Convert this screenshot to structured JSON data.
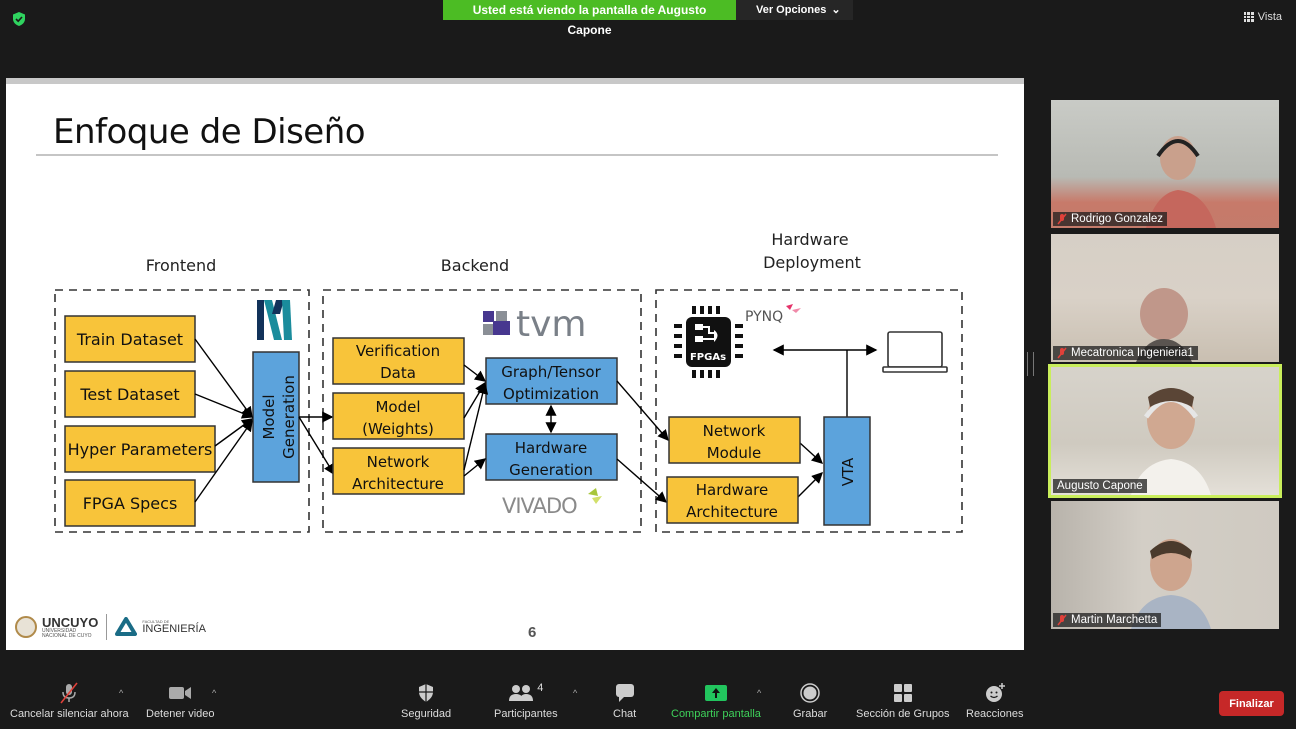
{
  "topbar": {
    "sharing_banner": "Usted está viendo la pantalla de Augusto Capone",
    "view_options": "Ver Opciones",
    "view_label": "Vista"
  },
  "slide": {
    "title": "Enfoque de Diseño",
    "page_number": "6",
    "footer": {
      "university": "UNCUYO",
      "university_sub1": "UNIVERSIDAD",
      "university_sub2": "NACIONAL DE CUYO",
      "faculty_sub": "FACULTAD DE",
      "faculty": "INGENIERÍA"
    },
    "diagram": {
      "sections": {
        "frontend": "Frontend",
        "backend": "Backend",
        "deployment_line1": "Hardware",
        "deployment_line2": "Deployment"
      },
      "frontend_inputs": [
        "Train Dataset",
        "Test Dataset",
        "Hyper Parameters",
        "FPGA Specs"
      ],
      "model_generation": [
        "Model",
        "Generation"
      ],
      "backend_inputs": [
        [
          "Verification",
          "Data"
        ],
        [
          "Model",
          "(Weights)"
        ],
        [
          "Network",
          "Architecture"
        ]
      ],
      "backend_blocks": [
        [
          "Graph/Tensor",
          "Optimization"
        ],
        [
          "Hardware",
          "Generation"
        ]
      ],
      "deployment_inputs": [
        [
          "Network",
          "Module"
        ],
        [
          "Hardware",
          "Architecture"
        ]
      ],
      "vta": "VTA",
      "logos": {
        "tvm": "tvm",
        "vivado": "VIVADO",
        "pynq": "PYNQ",
        "fpga": "FPGAs"
      },
      "colors": {
        "yellow": "#f8c43a",
        "blue": "#5ca3dc",
        "tvm_purple": "#47378f"
      }
    }
  },
  "participants": [
    {
      "name": "Rodrigo Gonzalez",
      "muted": true
    },
    {
      "name": "Mecatronica Ingenieria1",
      "muted": true
    },
    {
      "name": "Augusto Capone",
      "muted": false,
      "active_speaker": true
    },
    {
      "name": "Martin Marchetta",
      "muted": true
    }
  ],
  "toolbar": {
    "unmute": "Cancelar silenciar ahora",
    "stop_video": "Detener video",
    "security": "Seguridad",
    "participants": "Participantes",
    "participants_count": "4",
    "chat": "Chat",
    "share_screen": "Compartir pantalla",
    "record": "Grabar",
    "breakout": "Sección de Grupos",
    "reactions": "Reacciones",
    "end": "Finalizar"
  }
}
